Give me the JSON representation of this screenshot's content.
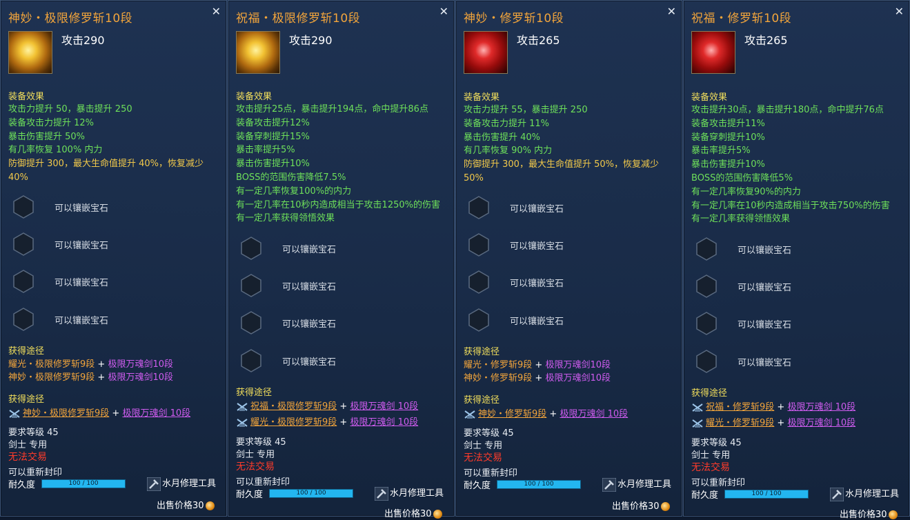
{
  "panels": [
    {
      "title": "神妙・极限修罗斩10段",
      "attack": "攻击290",
      "icon": "gold-sword-icon",
      "effect_header": "装备效果",
      "effects": [
        "攻击力提升 50，暴击提升 250",
        "装备攻击力提升 12%",
        "暴击伤害提升 50%",
        "有几率恢复 100% 内力"
      ],
      "effects_orange": [
        "防御提升 300，最大生命值提升 40%，恢复减少",
        "40%"
      ],
      "socket_text": "可以镶嵌宝石",
      "route_header": "获得途径",
      "routes": [
        {
          "a": "耀光・极限修罗斩9段",
          "b": "极限万魂剑10段"
        },
        {
          "a": "神妙・极限修罗斩9段",
          "b": "极限万魂剑10段"
        }
      ],
      "route_header2": "获得途径",
      "routes2": [
        {
          "a": "神妙・极限修罗斩9段",
          "b": "极限万魂剑 10段"
        }
      ],
      "req_level": "要求等级 45",
      "class_only": "剑士 专用",
      "no_trade": "无法交易",
      "reseal": "可以重新封印",
      "durability_label": "耐久度",
      "durability": "100 / 100",
      "repair_tool": "水月修理工具",
      "sell_price": "出售价格30"
    },
    {
      "title": "祝福・极限修罗斩10段",
      "attack": "攻击290",
      "icon": "gold-sword-icon",
      "effect_header": "装备效果",
      "effects": [
        "攻击提升25点，暴击提升194点，命中提升86点",
        "装备攻击提升12%",
        "装备穿刺提升15%",
        "暴击率提升5%",
        "暴击伤害提升10%",
        "BOSS的范围伤害降低7.5%",
        "有一定几率恢复100%的内力",
        "有一定几率在10秒内造成相当于攻击1250%的伤害",
        "有一定几率获得领悟效果"
      ],
      "socket_text": "可以镶嵌宝石",
      "route_header": "获得途径",
      "routes": [
        {
          "a": "祝福・极限修罗斩9段",
          "b": "极限万魂剑 10段"
        },
        {
          "a": "耀光・极限修罗斩9段",
          "b": "极限万魂剑 10段"
        }
      ],
      "req_level": "要求等级 45",
      "class_only": "剑士 专用",
      "no_trade": "无法交易",
      "reseal": "可以重新封印",
      "durability_label": "耐久度",
      "durability": "100 / 100",
      "repair_tool": "水月修理工具",
      "sell_price": "出售价格30"
    },
    {
      "title": "神妙・修罗斩10段",
      "attack": "攻击265",
      "icon": "red-sword-icon",
      "effect_header": "装备效果",
      "effects": [
        "攻击力提升 55，暴击提升 250",
        "装备攻击力提升 11%",
        "暴击伤害提升 40%",
        "有几率恢复 90% 内力"
      ],
      "effects_orange": [
        "防御提升 300，最大生命值提升 50%，恢复减少",
        "50%"
      ],
      "socket_text": "可以镶嵌宝石",
      "route_header": "获得途径",
      "routes": [
        {
          "a": "耀光・修罗斩9段",
          "b": "极限万魂剑10段"
        },
        {
          "a": "神妙・修罗斩9段",
          "b": "极限万魂剑10段"
        }
      ],
      "route_header2": "获得途径",
      "routes2": [
        {
          "a": "神妙・修罗斩9段",
          "b": "极限万魂剑 10段"
        }
      ],
      "req_level": "要求等级 45",
      "class_only": "剑士 专用",
      "no_trade": "无法交易",
      "reseal": "可以重新封印",
      "durability_label": "耐久度",
      "durability": "100 / 100",
      "repair_tool": "水月修理工具",
      "sell_price": "出售价格30"
    },
    {
      "title": "祝福・修罗斩10段",
      "attack": "攻击265",
      "icon": "red-sword-icon",
      "effect_header": "装备效果",
      "effects": [
        "攻击提升30点，暴击提升180点，命中提升76点",
        "装备攻击提升11%",
        "装备穿刺提升10%",
        "暴击率提升5%",
        "暴击伤害提升10%",
        "BOSS的范围伤害降低5%",
        "有一定几率恢复90%的内力",
        "有一定几率在10秒内造成相当于攻击750%的伤害",
        "有一定几率获得领悟效果"
      ],
      "socket_text": "可以镶嵌宝石",
      "route_header": "获得途径",
      "routes": [
        {
          "a": "祝福・修罗斩9段",
          "b": "极限万魂剑 10段"
        },
        {
          "a": "耀光・修罗斩9段",
          "b": "极限万魂剑 10段"
        }
      ],
      "req_level": "要求等级 45",
      "class_only": "剑士 专用",
      "no_trade": "无法交易",
      "reseal": "可以重新封印",
      "durability_label": "耐久度",
      "durability": "100 / 100",
      "repair_tool": "水月修理工具",
      "sell_price": "出售价格30"
    }
  ]
}
